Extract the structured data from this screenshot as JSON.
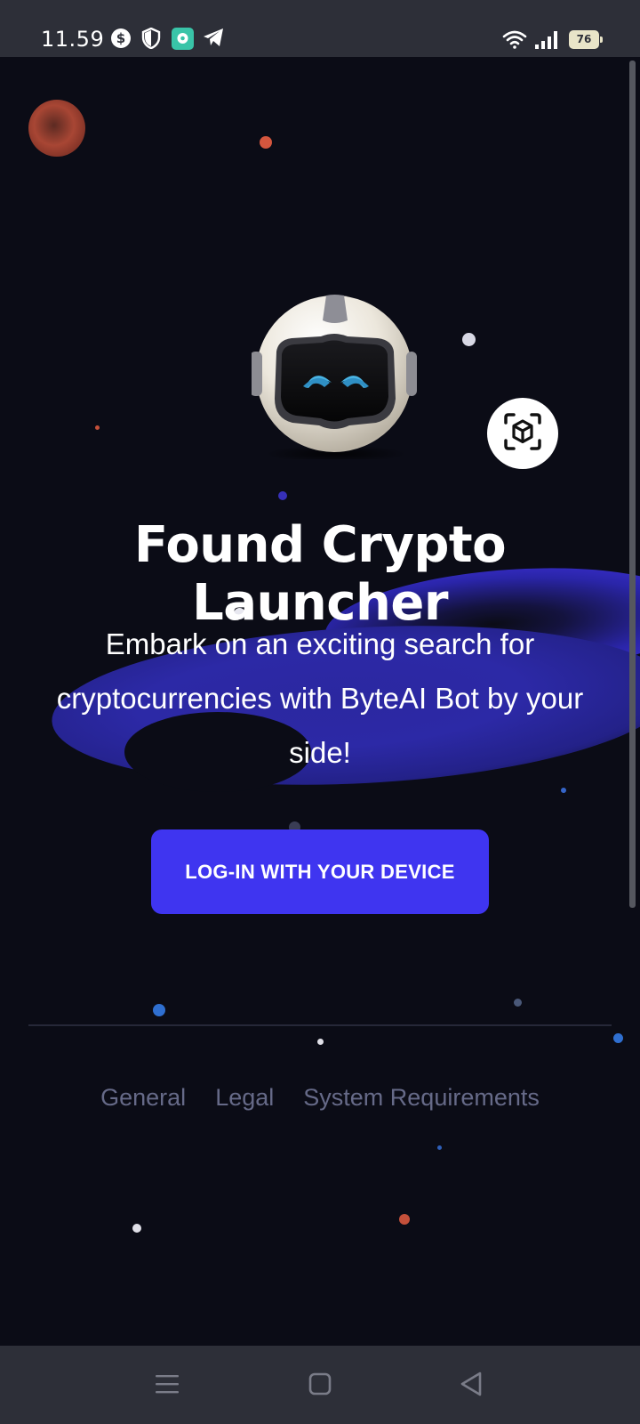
{
  "status_bar": {
    "time": "11.59",
    "battery": "76",
    "icons": [
      "dollar-circle-icon",
      "shield-icon",
      "chat-app-icon",
      "telegram-icon",
      "wifi-icon",
      "signal-icon",
      "battery-icon"
    ]
  },
  "hero": {
    "title": "Found Crypto Launcher",
    "subtitle": "Embark on an exciting search for cryptocurrencies with ByteAI Bot by your side!",
    "robot_icon": "robot-mascot-icon",
    "ar_icon": "ar-cube-icon"
  },
  "login": {
    "label": "LOG-IN WITH YOUR DEVICE"
  },
  "footer": {
    "links": [
      "General",
      "Legal",
      "System Requirements"
    ]
  },
  "nav_bar": {
    "icons": [
      "menu-icon",
      "home-square-icon",
      "back-triangle-icon"
    ]
  },
  "colors": {
    "background": "#0b0c16",
    "accent": "#3f35f0",
    "bars": "#2d2f38",
    "footer_text": "#666a88"
  }
}
